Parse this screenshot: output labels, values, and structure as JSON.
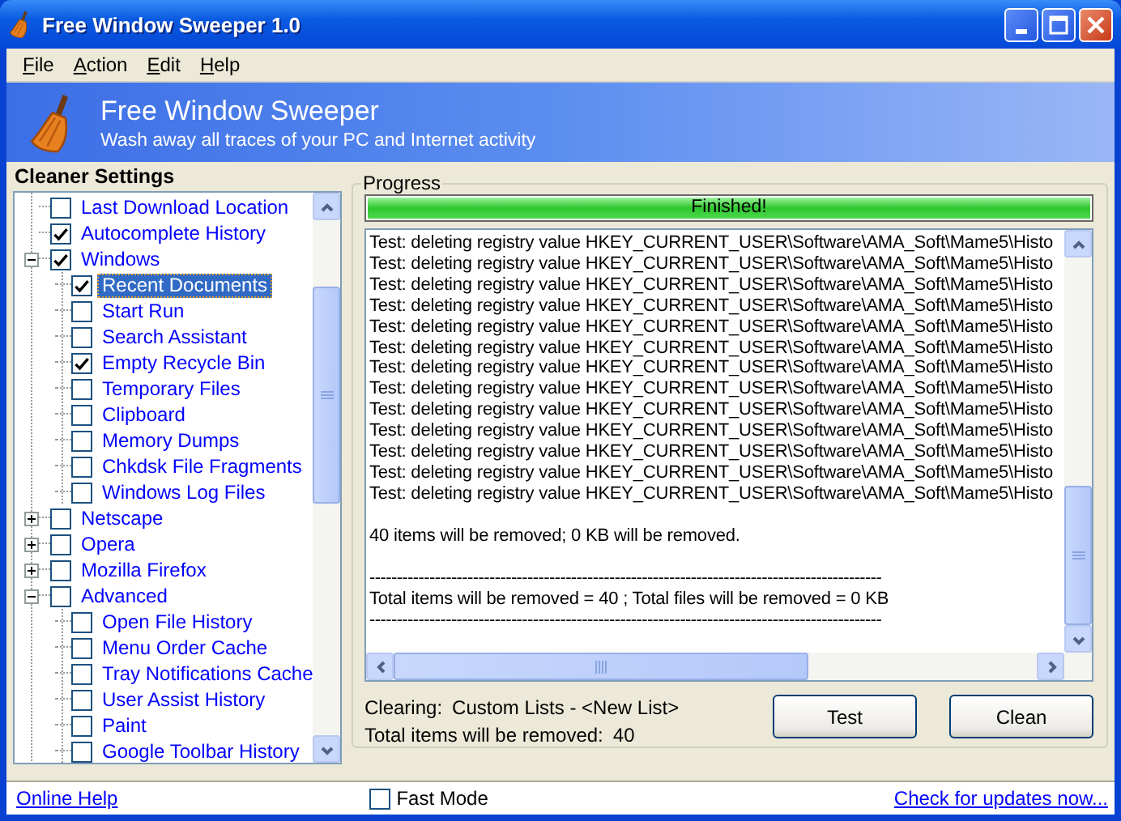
{
  "window": {
    "title": "Free Window Sweeper 1.0"
  },
  "menu": [
    {
      "label": "File"
    },
    {
      "label": "Action"
    },
    {
      "label": "Edit"
    },
    {
      "label": "Help"
    }
  ],
  "banner": {
    "title": "Free Window Sweeper",
    "subtitle": "Wash away all traces of your PC and Internet activity"
  },
  "settings": {
    "heading": "Cleaner Settings",
    "tree": [
      {
        "children": [
          {
            "label": "Last Download Location",
            "checked": false,
            "selected": false
          },
          {
            "label": "Autocomplete History",
            "checked": true,
            "selected": false
          }
        ]
      },
      {
        "label": "Windows",
        "checked": true,
        "expanded": true,
        "selected": false,
        "children": [
          {
            "label": "Recent Documents",
            "checked": true,
            "selected": true
          },
          {
            "label": "Start Run",
            "checked": false,
            "selected": false
          },
          {
            "label": "Search Assistant",
            "checked": false,
            "selected": false
          },
          {
            "label": "Empty Recycle Bin",
            "checked": true,
            "selected": false
          },
          {
            "label": "Temporary Files",
            "checked": false,
            "selected": false
          },
          {
            "label": "Clipboard",
            "checked": false,
            "selected": false
          },
          {
            "label": "Memory Dumps",
            "checked": false,
            "selected": false
          },
          {
            "label": "Chkdsk File Fragments",
            "checked": false,
            "selected": false
          },
          {
            "label": "Windows Log Files",
            "checked": false,
            "selected": false
          }
        ]
      },
      {
        "label": "Netscape",
        "checked": false,
        "expanded": false,
        "selected": false
      },
      {
        "label": "Opera",
        "checked": false,
        "expanded": false,
        "selected": false
      },
      {
        "label": "Mozilla Firefox",
        "checked": false,
        "expanded": false,
        "selected": false
      },
      {
        "label": "Advanced",
        "checked": false,
        "expanded": true,
        "selected": false,
        "children": [
          {
            "label": "Open File History",
            "checked": false,
            "selected": false
          },
          {
            "label": "Menu Order Cache",
            "checked": false,
            "selected": false
          },
          {
            "label": "Tray Notifications Cache",
            "checked": false,
            "selected": false
          },
          {
            "label": "User Assist History",
            "checked": false,
            "selected": false
          },
          {
            "label": "Paint",
            "checked": false,
            "selected": false
          },
          {
            "label": "Google Toolbar History",
            "checked": false,
            "selected": false
          }
        ]
      }
    ]
  },
  "progress": {
    "legend": "Progress",
    "level": 1,
    "status": "Finished!",
    "log": [
      {
        "kind": "entry",
        "text": "Test: deleting registry value HKEY_CURRENT_USER\\Software\\AMA_Soft\\Mame5\\Histo"
      },
      {
        "kind": "entry",
        "text": "Test: deleting registry value HKEY_CURRENT_USER\\Software\\AMA_Soft\\Mame5\\Histo"
      },
      {
        "kind": "entry",
        "text": "Test: deleting registry value HKEY_CURRENT_USER\\Software\\AMA_Soft\\Mame5\\Histo"
      },
      {
        "kind": "entry",
        "text": "Test: deleting registry value HKEY_CURRENT_USER\\Software\\AMA_Soft\\Mame5\\Histo"
      },
      {
        "kind": "entry",
        "text": "Test: deleting registry value HKEY_CURRENT_USER\\Software\\AMA_Soft\\Mame5\\Histo"
      },
      {
        "kind": "entry",
        "text": "Test: deleting registry value HKEY_CURRENT_USER\\Software\\AMA_Soft\\Mame5\\Histo"
      },
      {
        "kind": "entry",
        "text": "Test: deleting registry value HKEY_CURRENT_USER\\Software\\AMA_Soft\\Mame5\\Histo"
      },
      {
        "kind": "entry",
        "text": "Test: deleting registry value HKEY_CURRENT_USER\\Software\\AMA_Soft\\Mame5\\Histo"
      },
      {
        "kind": "entry",
        "text": "Test: deleting registry value HKEY_CURRENT_USER\\Software\\AMA_Soft\\Mame5\\Histo"
      },
      {
        "kind": "entry",
        "text": "Test: deleting registry value HKEY_CURRENT_USER\\Software\\AMA_Soft\\Mame5\\Histo"
      },
      {
        "kind": "entry",
        "text": "Test: deleting registry value HKEY_CURRENT_USER\\Software\\AMA_Soft\\Mame5\\Histo"
      },
      {
        "kind": "entry",
        "text": "Test: deleting registry value HKEY_CURRENT_USER\\Software\\AMA_Soft\\Mame5\\Histo"
      },
      {
        "kind": "entry",
        "text": "Test: deleting registry value HKEY_CURRENT_USER\\Software\\AMA_Soft\\Mame5\\Histo"
      },
      {
        "kind": "note",
        "text": "40 items will be removed; 0 KB will be removed."
      },
      {
        "kind": "rule",
        "text": "----------------------------------------------------------------------------------------------"
      },
      {
        "kind": "total",
        "text": "Total items will be removed = 40 ; Total files will be removed = 0 KB"
      },
      {
        "kind": "rule",
        "text": "----------------------------------------------------------------------------------------------"
      }
    ],
    "clearing_label": "Clearing:",
    "clearing_value": "Custom Lists - <New List>",
    "total_label": "Total items will be removed:",
    "total_value": "40",
    "buttons": [
      "Test",
      "Clean"
    ]
  },
  "footer": {
    "help_link": "Online Help",
    "fast_mode": {
      "label": "Fast Mode",
      "checked": false
    },
    "update_link": "Check for updates now..."
  }
}
